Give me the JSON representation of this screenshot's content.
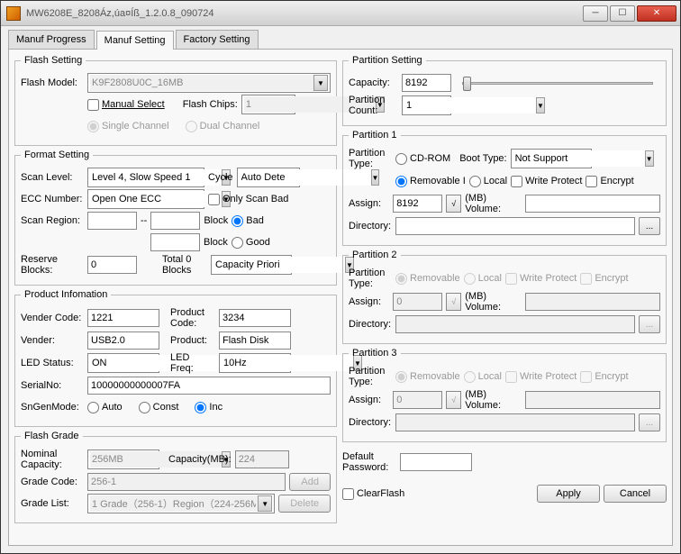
{
  "window": {
    "title": "MW6208E_8208Áz,úa¤Íß_1.2.0.8_090724"
  },
  "tabs": {
    "manuf_progress": "Manuf Progress",
    "manuf_setting": "Manuf Setting",
    "factory_setting": "Factory Setting"
  },
  "flash_setting": {
    "legend": "Flash Setting",
    "flash_model_label": "Flash Model:",
    "flash_model_value": "K9F2808U0C_16MB",
    "manual_select": "Manual Select",
    "flash_chips_label": "Flash Chips:",
    "flash_chips_value": "1",
    "single_channel": "Single Channel",
    "dual_channel": "Dual Channel"
  },
  "format_setting": {
    "legend": "Format Setting",
    "scan_level_label": "Scan Level:",
    "scan_level_value": "Level 4, Slow Speed 1",
    "cycle_label": "Cycle",
    "cycle_value": "Auto Dete",
    "ecc_label": "ECC Number:",
    "ecc_value": "Open One ECC",
    "only_scan_bad": "Only Scan Bad",
    "scan_region_label": "Scan Region:",
    "block_label": "Block",
    "bad": "Bad",
    "good": "Good",
    "dash": "--",
    "reserve_blocks_label": "Reserve Blocks:",
    "reserve_blocks_value": "0",
    "total_blocks": "Total 0 Blocks",
    "capacity_priority": "Capacity Priori"
  },
  "product_info": {
    "legend": "Product Infomation",
    "vender_code_label": "Vender Code:",
    "vender_code_value": "1221",
    "product_code_label": "Product Code:",
    "product_code_value": "3234",
    "vender_label": "Vender:",
    "vender_value": "USB2.0",
    "product_label": "Product:",
    "product_value": "Flash Disk",
    "led_status_label": "LED Status:",
    "led_status_value": "ON",
    "led_freq_label": "LED Freq:",
    "led_freq_value": "10Hz",
    "serial_label": "SerialNo:",
    "serial_value": "10000000000007FA",
    "sn_mode_label": "SnGenMode:",
    "auto": "Auto",
    "const": "Const",
    "inc": "Inc"
  },
  "flash_grade": {
    "legend": "Flash Grade",
    "nominal_label": "Nominal Capacity:",
    "nominal_value": "256MB",
    "capacity_mb_label": "Capacity(MB):",
    "capacity_mb_value": "224",
    "grade_code_label": "Grade Code:",
    "grade_code_value": "256-1",
    "add": "Add",
    "grade_list_label": "Grade List:",
    "grade_list_value": "1 Grade（256-1）Region（224-256M",
    "delete": "Delete"
  },
  "partition_setting": {
    "legend": "Partition Setting",
    "capacity_label": "Capacity:",
    "capacity_value": "8192",
    "partition_count_label": "Partition Count:",
    "partition_count_value": "1"
  },
  "partition1": {
    "legend": "Partition 1",
    "type_label": "Partition Type:",
    "cdrom": "CD-ROM",
    "removable": "Removable",
    "local": "Local",
    "boot_type_label": "Boot Type:",
    "boot_type_value": "Not Support",
    "write_protect": "Write Protect",
    "encrypt": "Encrypt",
    "assign_label": "Assign:",
    "assign_value": "8192",
    "mb_volume": "(MB) Volume:",
    "directory_label": "Directory:"
  },
  "partition2": {
    "legend": "Partition 2",
    "type_label": "Partition Type:",
    "removable": "Removable",
    "local": "Local",
    "write_protect": "Write Protect",
    "encrypt": "Encrypt",
    "assign_label": "Assign:",
    "assign_value": "0",
    "mb_volume": "(MB) Volume:",
    "directory_label": "Directory:"
  },
  "partition3": {
    "legend": "Partition 3",
    "type_label": "Partition Type:",
    "removable": "Removable",
    "local": "Local",
    "write_protect": "Write Protect",
    "encrypt": "Encrypt",
    "assign_label": "Assign:",
    "assign_value": "0",
    "mb_volume": "(MB) Volume:",
    "directory_label": "Directory:"
  },
  "footer": {
    "default_password_label": "Default Password:",
    "clear_flash": "ClearFlash",
    "apply": "Apply",
    "cancel": "Cancel",
    "sqrt": "√",
    "ellipsis": "...",
    "removable_i": "Removable I"
  }
}
